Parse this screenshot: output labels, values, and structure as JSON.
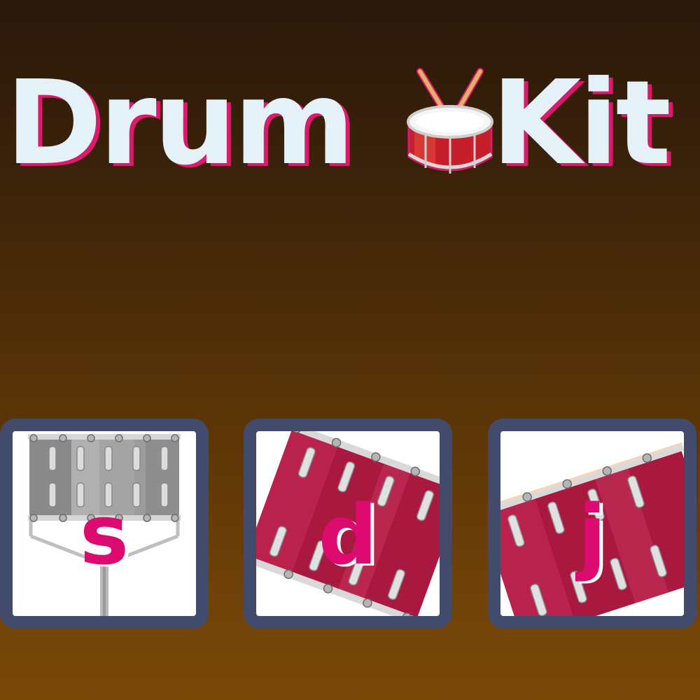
{
  "header": {
    "title_left": "Drum",
    "title_right": "Kit",
    "title_icon": "drum-with-sticks-icon"
  },
  "pads": [
    {
      "key": "s",
      "drum": "snare-drum-icon"
    },
    {
      "key": "d",
      "drum": "tom-drum-icon"
    },
    {
      "key": "j",
      "drum": "bass-drum-icon"
    }
  ],
  "colors": {
    "background_top": "#2a180b",
    "background_bottom": "#7a4908",
    "title_text": "#e4f1f7",
    "accent_pink": "#dc1a6c",
    "pad_border": "#424b6b",
    "drum_red": "#a3153a"
  }
}
